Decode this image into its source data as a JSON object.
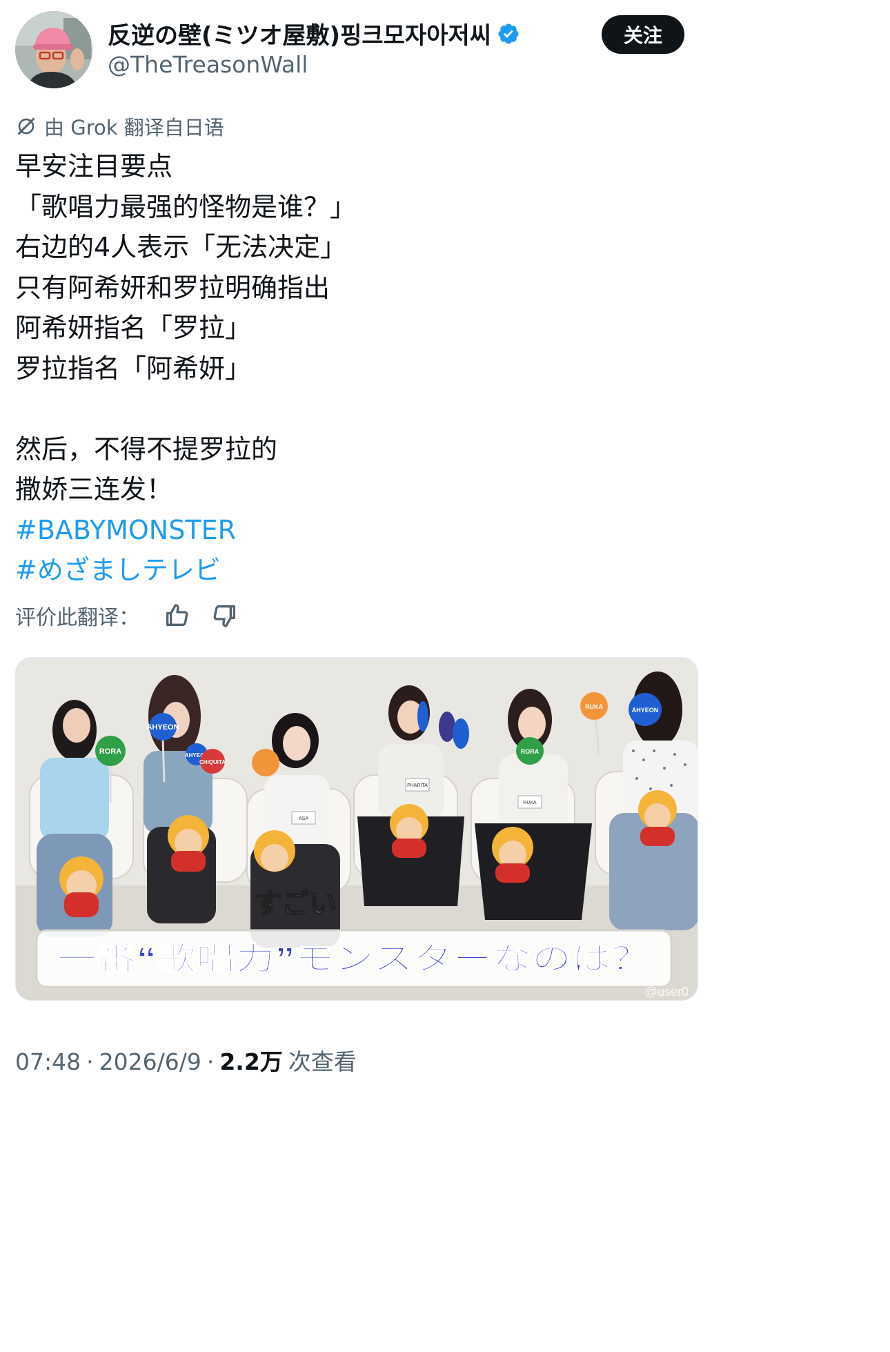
{
  "author": {
    "display_name": "反逆の壁(ミツオ屋敷)핑크모자아저씨",
    "handle": "@TheTreasonWall",
    "verified": true,
    "follow_label": "关注"
  },
  "translation": {
    "label": "由 Grok 翻译自日语",
    "rate_label": "评价此翻译："
  },
  "tweet": {
    "lines": [
      "早安注目要点",
      "「歌唱力最强的怪物是谁？」",
      "右边的4人表示「无法决定」",
      "只有阿希妍和罗拉明确指出",
      "阿希妍指名「罗拉」",
      "罗拉指名「阿希妍」",
      "",
      "然后，不得不提罗拉的",
      "撒娇三连发！"
    ],
    "hashtags": [
      "#BABYMONSTER",
      "#めざましテレビ"
    ]
  },
  "media": {
    "caption_top": "すごい",
    "caption_bottom": "一番“歌唱力”モンスターなのは？",
    "watermark": "@user0",
    "paddles": [
      "RORA",
      "AHYEON",
      "AHYEON",
      "CHIQUITA",
      "RORA",
      "RUKA",
      "AHYEON"
    ],
    "name_tags": [
      "ASA",
      "PHARITA",
      "RUKA"
    ]
  },
  "meta": {
    "time": "07:48",
    "date": "2026/6/9",
    "views_count": "2.2万",
    "views_label": "次查看"
  },
  "colors": {
    "link": "#1d9bf0",
    "text_primary": "#0f1419",
    "text_secondary": "#536471",
    "verified": "#1d9bf0"
  }
}
